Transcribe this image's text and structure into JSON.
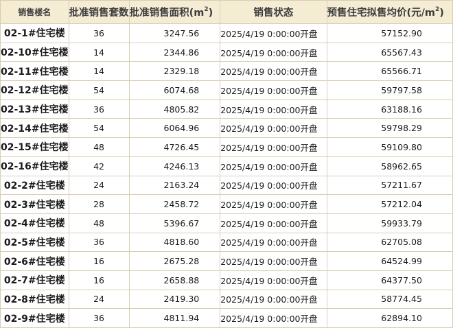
{
  "headers": {
    "building": "销售楼名",
    "units": "批准销售套数",
    "area_prefix": "批准销售面积(m",
    "area_sup": "2",
    "area_suffix": ")",
    "status": "销售状态",
    "price_prefix": "预售住宅拟售均价(元/m",
    "price_sup": "2",
    "price_suffix": ")"
  },
  "rows": [
    {
      "building": "02-1#住宅楼",
      "units": "36",
      "area": "3247.56",
      "status": "2025/4/19 0:00:00开盘",
      "price": "57152.90"
    },
    {
      "building": "02-10#住宅楼",
      "units": "14",
      "area": "2344.86",
      "status": "2025/4/19 0:00:00开盘",
      "price": "65567.43"
    },
    {
      "building": "02-11#住宅楼",
      "units": "14",
      "area": "2329.18",
      "status": "2025/4/19 0:00:00开盘",
      "price": "65566.71"
    },
    {
      "building": "02-12#住宅楼",
      "units": "54",
      "area": "6074.68",
      "status": "2025/4/19 0:00:00开盘",
      "price": "59797.58"
    },
    {
      "building": "02-13#住宅楼",
      "units": "36",
      "area": "4805.82",
      "status": "2025/4/19 0:00:00开盘",
      "price": "63188.16"
    },
    {
      "building": "02-14#住宅楼",
      "units": "54",
      "area": "6064.96",
      "status": "2025/4/19 0:00:00开盘",
      "price": "59798.29"
    },
    {
      "building": "02-15#住宅楼",
      "units": "48",
      "area": "4726.45",
      "status": "2025/4/19 0:00:00开盘",
      "price": "59109.80"
    },
    {
      "building": "02-16#住宅楼",
      "units": "42",
      "area": "4246.13",
      "status": "2025/4/19 0:00:00开盘",
      "price": "58962.65"
    },
    {
      "building": "02-2#住宅楼",
      "units": "24",
      "area": "2163.24",
      "status": "2025/4/19 0:00:00开盘",
      "price": "57211.67"
    },
    {
      "building": "02-3#住宅楼",
      "units": "28",
      "area": "2458.72",
      "status": "2025/4/19 0:00:00开盘",
      "price": "57212.04"
    },
    {
      "building": "02-4#住宅楼",
      "units": "48",
      "area": "5396.67",
      "status": "2025/4/19 0:00:00开盘",
      "price": "59933.79"
    },
    {
      "building": "02-5#住宅楼",
      "units": "36",
      "area": "4818.60",
      "status": "2025/4/19 0:00:00开盘",
      "price": "62705.08"
    },
    {
      "building": "02-6#住宅楼",
      "units": "16",
      "area": "2675.28",
      "status": "2025/4/19 0:00:00开盘",
      "price": "64524.99"
    },
    {
      "building": "02-7#住宅楼",
      "units": "16",
      "area": "2658.88",
      "status": "2025/4/19 0:00:00开盘",
      "price": "64377.50"
    },
    {
      "building": "02-8#住宅楼",
      "units": "24",
      "area": "2419.30",
      "status": "2025/4/19 0:00:00开盘",
      "price": "58774.45"
    },
    {
      "building": "02-9#住宅楼",
      "units": "36",
      "area": "4811.94",
      "status": "2025/4/19 0:00:00开盘",
      "price": "62894.10"
    }
  ],
  "colors": {
    "header_bg": "#f5ecd4",
    "border": "#d9cdb1"
  }
}
